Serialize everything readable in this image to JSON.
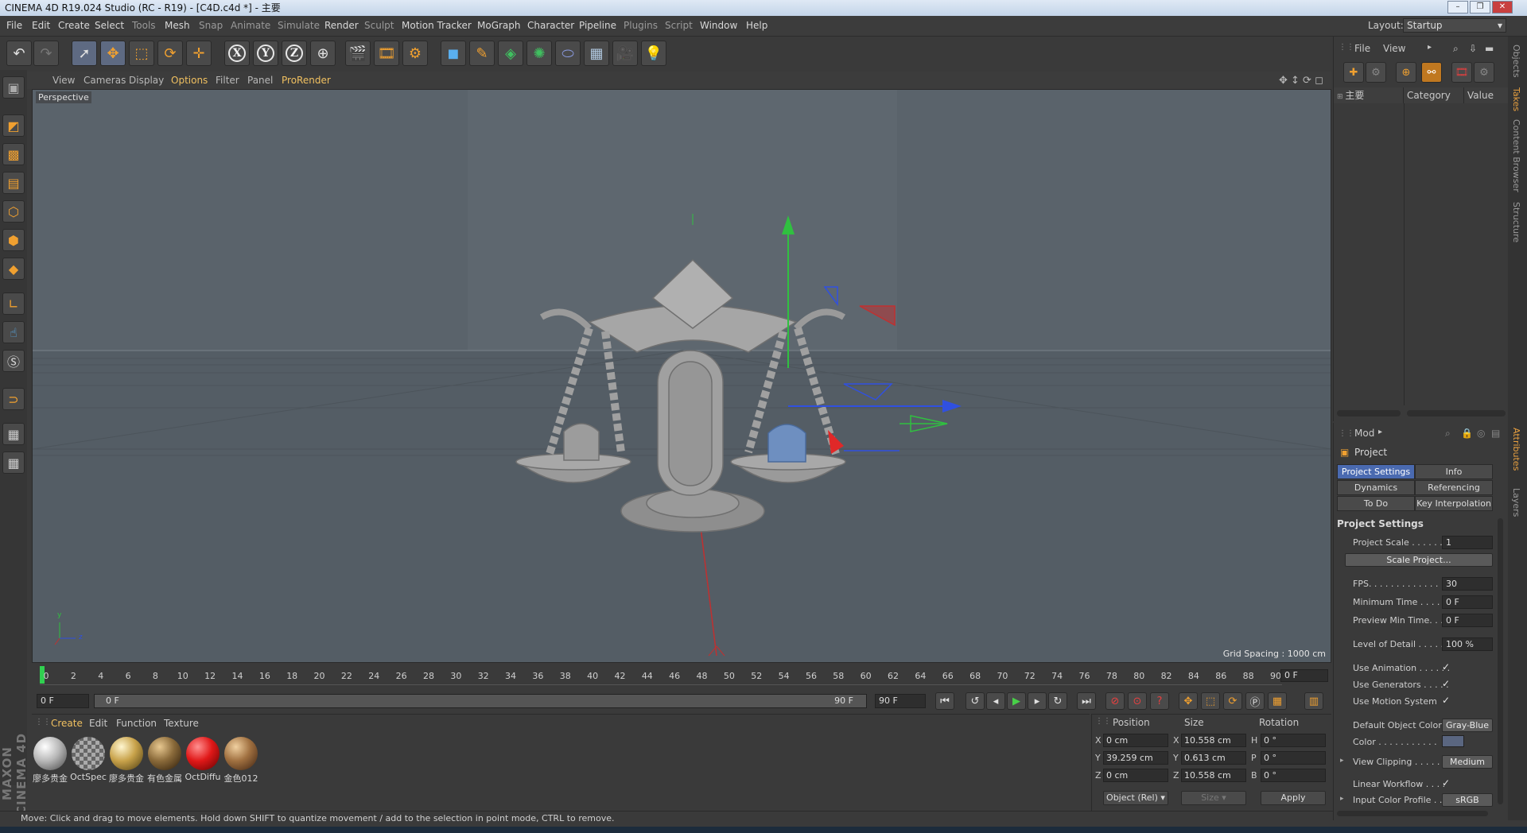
{
  "window": {
    "title": "CINEMA 4D R19.024 Studio (RC - R19) - [C4D.c4d *] - 主要",
    "controls": [
      "–",
      "❐",
      "✕"
    ]
  },
  "menubar": {
    "items": [
      "File",
      "Edit",
      "Create",
      "Select",
      "Tools",
      "Mesh",
      "Snap",
      "Animate",
      "Simulate",
      "Render",
      "Sculpt",
      "Motion Tracker",
      "MoGraph",
      "Character",
      "Pipeline",
      "Plugins",
      "Script",
      "Window",
      "Help"
    ],
    "layout_label": "Layout:",
    "layout_value": "Startup"
  },
  "toolbar": {
    "axis_x": "X",
    "axis_y": "Y",
    "axis_z": "Z"
  },
  "viewport": {
    "menu": [
      "View",
      "Cameras",
      "Display",
      "Options",
      "Filter",
      "Panel",
      "ProRender"
    ],
    "label": "Perspective",
    "grid_spacing": "Grid Spacing : 1000 cm",
    "axis_y": "y",
    "axis_z": "z"
  },
  "timeline": {
    "ticks": [
      "0",
      "2",
      "4",
      "6",
      "8",
      "10",
      "12",
      "14",
      "16",
      "18",
      "20",
      "22",
      "24",
      "26",
      "28",
      "30",
      "32",
      "34",
      "36",
      "38",
      "40",
      "42",
      "44",
      "46",
      "48",
      "50",
      "52",
      "54",
      "56",
      "58",
      "60",
      "62",
      "64",
      "66",
      "68",
      "70",
      "72",
      "74",
      "76",
      "78",
      "80",
      "82",
      "84",
      "86",
      "88",
      "90"
    ],
    "current_frame": "0 F"
  },
  "transport": {
    "start": "0 F",
    "range_start": "0 F",
    "range_end": "90 F",
    "end": "90 F"
  },
  "materials": {
    "menu": [
      "Create",
      "Edit",
      "Function",
      "Texture"
    ],
    "items": [
      {
        "label": "廖多贵金",
        "color": "#b8b8b8"
      },
      {
        "label": "OctSpec",
        "color": "#9aa0a8"
      },
      {
        "label": "廖多贵金",
        "color": "#c8a24a"
      },
      {
        "label": "有色金属",
        "color": "#8a6a3a"
      },
      {
        "label": "OctDiffu",
        "color": "#e01818"
      },
      {
        "label": "金色012",
        "color": "#a07040"
      }
    ],
    "logo": "MAXON CINEMA 4D"
  },
  "coordinates": {
    "headers": [
      "Position",
      "Size",
      "Rotation"
    ],
    "rows": [
      {
        "pa": "X",
        "pv": "0 cm",
        "sa": "X",
        "sv": "10.558 cm",
        "ra": "H",
        "rv": "0 °"
      },
      {
        "pa": "Y",
        "pv": "39.259 cm",
        "sa": "Y",
        "sv": "0.613 cm",
        "ra": "P",
        "rv": "0 °"
      },
      {
        "pa": "Z",
        "pv": "0 cm",
        "sa": "Z",
        "sv": "10.558 cm",
        "ra": "B",
        "rv": "0 °"
      }
    ],
    "mode": "Object (Rel)",
    "size_mode": "Size",
    "apply": "Apply"
  },
  "status": "Move: Click and drag to move elements. Hold down SHIFT to quantize movement / add to the selection in point mode, CTRL to remove.",
  "objects": {
    "menu": [
      "File",
      "View"
    ],
    "columns": [
      "主要",
      "Category",
      "Value"
    ]
  },
  "attributes": {
    "menu": "Mod",
    "title": "Project",
    "tabs": [
      "Project Settings",
      "Info",
      "Dynamics",
      "Referencing",
      "To Do",
      "Key Interpolation"
    ],
    "section": "Project Settings",
    "rows": [
      {
        "label": "Project Scale . . . . . .",
        "value": "1"
      },
      {
        "label": "FPS. . . . . . . . . . . . . .",
        "value": "30"
      },
      {
        "label": "Minimum Time . . . . .",
        "value": "0 F"
      },
      {
        "label": "Preview Min Time. . . .",
        "value": "0 F"
      },
      {
        "label": "Level of Detail . . . . .",
        "value": "100 %"
      }
    ],
    "scale_button": "Scale Project...",
    "checks": [
      {
        "label": "Use Animation . . . . . .",
        "value": "✓"
      },
      {
        "label": "Use Generators . . . . .",
        "value": "✓"
      },
      {
        "label": "Use Motion System",
        "value": "✓"
      }
    ],
    "default_color_label": "Default Object Color",
    "default_color_value": "Gray-Blue",
    "color_label": "Color . . . . . . . . . . .",
    "clipping_label": "View Clipping . . . . . .",
    "clipping_value": "Medium",
    "workflow_label": "Linear Workflow . . . .",
    "workflow_value": "✓",
    "profile_label": "Input Color Profile . . .",
    "profile_value": "sRGB"
  },
  "right_tabs": [
    "Objects",
    "Takes",
    "Content Browser",
    "Structure",
    "Attributes",
    "Layers"
  ]
}
